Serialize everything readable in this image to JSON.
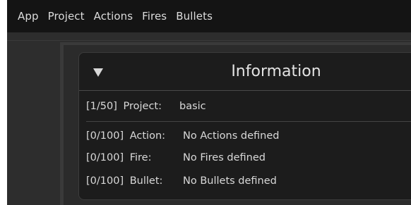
{
  "menubar": {
    "items": [
      {
        "label": "App"
      },
      {
        "label": "Project"
      },
      {
        "label": "Actions"
      },
      {
        "label": "Fires"
      },
      {
        "label": "Bullets"
      }
    ]
  },
  "panel": {
    "title": "Information",
    "collapse_icon": "triangle-down-icon",
    "project": {
      "count": "[1/50]",
      "label": "Project:",
      "value": "basic"
    },
    "rows": [
      {
        "count": "[0/100]",
        "label": "Action:",
        "value": "No Actions defined"
      },
      {
        "count": "[0/100]",
        "label": "Fire:",
        "value": "No Fires defined"
      },
      {
        "count": "[0/100]",
        "label": "Bullet:",
        "value": "No Bullets defined"
      }
    ]
  },
  "colors": {
    "menubar_bg": "#141414",
    "canvas_bg": "#2d2d2d",
    "panel_bg": "#1c1c1c",
    "text": "#d9d9d9"
  }
}
